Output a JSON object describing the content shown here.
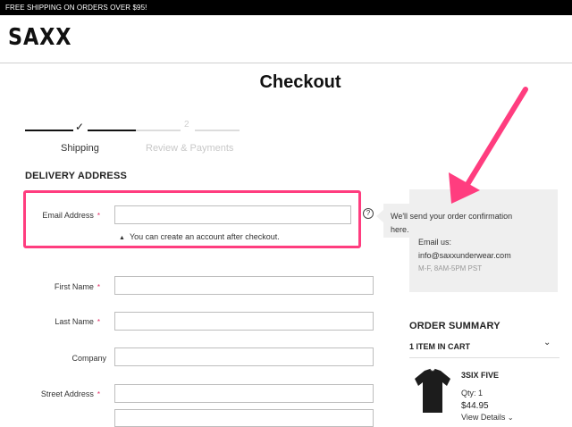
{
  "promo": {
    "text": "FREE SHIPPING ON ORDERS OVER $95!"
  },
  "brand": {
    "logo": "SAXX"
  },
  "page": {
    "title": "Checkout"
  },
  "stepper": {
    "step1_icon": "check-icon",
    "step1_label": "Shipping",
    "step2_number": "2",
    "step2_label": "Review & Payments",
    "active_step": 1
  },
  "delivery": {
    "heading": "DELIVERY ADDRESS",
    "required_mark": "*",
    "email": {
      "label": "Email Address",
      "value": "",
      "hint": "You can create an account after checkout.",
      "hint_icon": "triangle-up-icon"
    },
    "first_name": {
      "label": "First Name",
      "value": ""
    },
    "last_name": {
      "label": "Last Name",
      "value": ""
    },
    "company": {
      "label": "Company",
      "value": ""
    },
    "street": {
      "label": "Street Address",
      "value": ""
    }
  },
  "help": {
    "icon_glyph": "?",
    "icon_name": "question-icon"
  },
  "info": {
    "tooltip": "We'll send your order confirmation here.",
    "email_label": "Email us:",
    "email": "info@saxxunderwear.com",
    "hours": "M-F, 8AM-5PM PST"
  },
  "summary": {
    "heading": "ORDER SUMMARY",
    "cart_count": "1 ITEM IN CART",
    "chevron_icon": "chevron-down-icon",
    "item": {
      "name": "3SIX FIVE",
      "qty": "Qty: 1",
      "price": "$44.95",
      "view_details": "View Details",
      "image_icon": "t-shirt-image"
    }
  },
  "colors": {
    "highlight": "#ff3d7f",
    "annotation_arrow": "#ff3d7f",
    "promo_bg": "#000000",
    "info_bg": "#efefef"
  }
}
